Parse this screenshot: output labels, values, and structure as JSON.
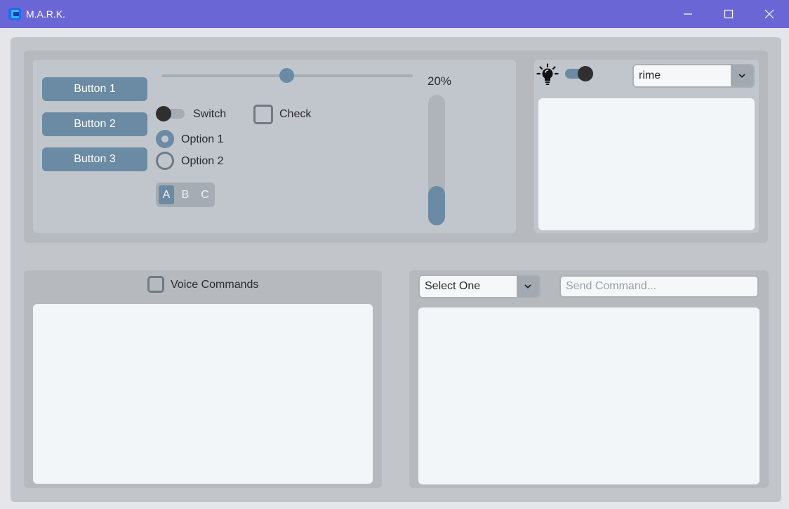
{
  "window": {
    "title": "M.A.R.K.",
    "controls": [
      "minimize-icon",
      "maximize-icon",
      "close-icon"
    ],
    "titlebar_color": "#6b66d6"
  },
  "controls": {
    "buttons": [
      "Button 1",
      "Button 2",
      "Button 3"
    ],
    "slider_value": 0.5,
    "switch": {
      "label": "Switch",
      "on": false
    },
    "checkbox": {
      "label": "Check",
      "checked": false
    },
    "radios": [
      {
        "label": "Option 1",
        "selected": true
      },
      {
        "label": "Option 2",
        "selected": false
      }
    ],
    "segmented": {
      "items": [
        "A",
        "B",
        "C"
      ],
      "selected": "A"
    },
    "progress": {
      "label": "20%",
      "value": 0.3
    }
  },
  "appearance": {
    "theme_icon": "lightbulb-icon",
    "theme_switch_on": true,
    "theme_select_value": "rime",
    "accent_color": "#6b8aa4"
  },
  "voice": {
    "checkbox_label": "Voice Commands",
    "checked": false
  },
  "command": {
    "select_value": "Select One",
    "input_placeholder": "Send Command...",
    "input_value": ""
  }
}
